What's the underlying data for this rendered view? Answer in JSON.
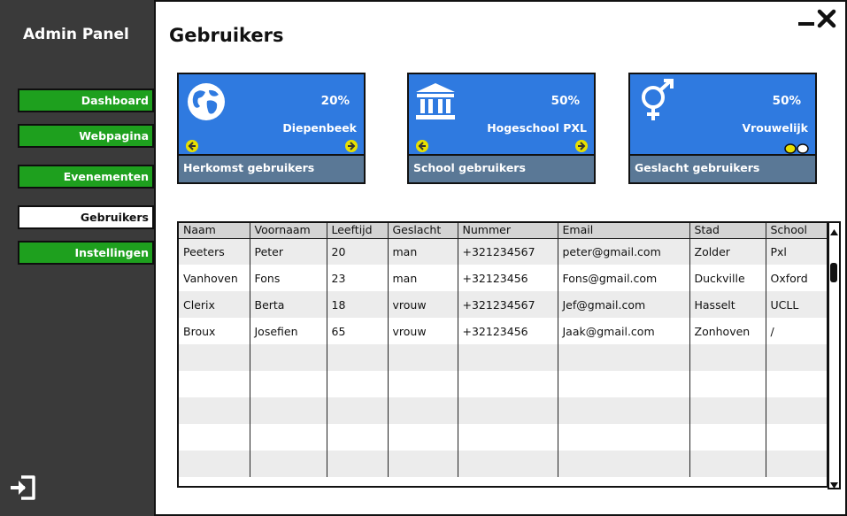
{
  "sidebar": {
    "title": "Admin Panel",
    "items": [
      {
        "label": "Dashboard",
        "active": false
      },
      {
        "label": "Webpagina",
        "active": false
      },
      {
        "label": "Evenementen",
        "active": false
      },
      {
        "label": "Gebruikers",
        "active": true
      },
      {
        "label": "Instellingen",
        "active": false
      }
    ],
    "logout_icon": "logout-icon"
  },
  "page": {
    "title": "Gebruikers"
  },
  "window": {
    "minimize_icon": "minimize-icon",
    "close_icon": "close-icon"
  },
  "cards": [
    {
      "percent": "20%",
      "label": "Diepenbeek",
      "footer": "Herkomst gebruikers",
      "icon": "globe-icon"
    },
    {
      "percent": "50%",
      "label": "Hogeschool PXL",
      "footer": "School gebruikers",
      "icon": "building-icon"
    },
    {
      "percent": "50%",
      "label": "Vrouwelijk",
      "footer": "Geslacht gebruikers",
      "icon": "gender-icon"
    }
  ],
  "colors": {
    "accent": "#2f7ae0",
    "nav_green": "#1ea01e",
    "sidebar_bg": "#3a3a3a",
    "card_footer": "#5a7896",
    "arrow_yellow": "#e8e000"
  },
  "table": {
    "columns": [
      "Naam",
      "Voornaam",
      "Leeftijd",
      "Geslacht",
      "Nummer",
      "Email",
      "Stad",
      "School"
    ],
    "rows": [
      [
        "Peeters",
        "Peter",
        "20",
        "man",
        "+321234567",
        "peter@gmail.com",
        "Zolder",
        "Pxl"
      ],
      [
        "Vanhoven",
        "Fons",
        "23",
        "man",
        "+32123456",
        "Fons@gmail.com",
        "Duckville",
        "Oxford"
      ],
      [
        "Clerix",
        "Berta",
        "18",
        "vrouw",
        "+321234567",
        "Jef@gmail.com",
        "Hasselt",
        "UCLL"
      ],
      [
        "Broux",
        "Josefien",
        "65",
        "vrouw",
        "+32123456",
        "Jaak@gmail.com",
        "Zonhoven",
        "/"
      ]
    ],
    "empty_rows": 5
  }
}
